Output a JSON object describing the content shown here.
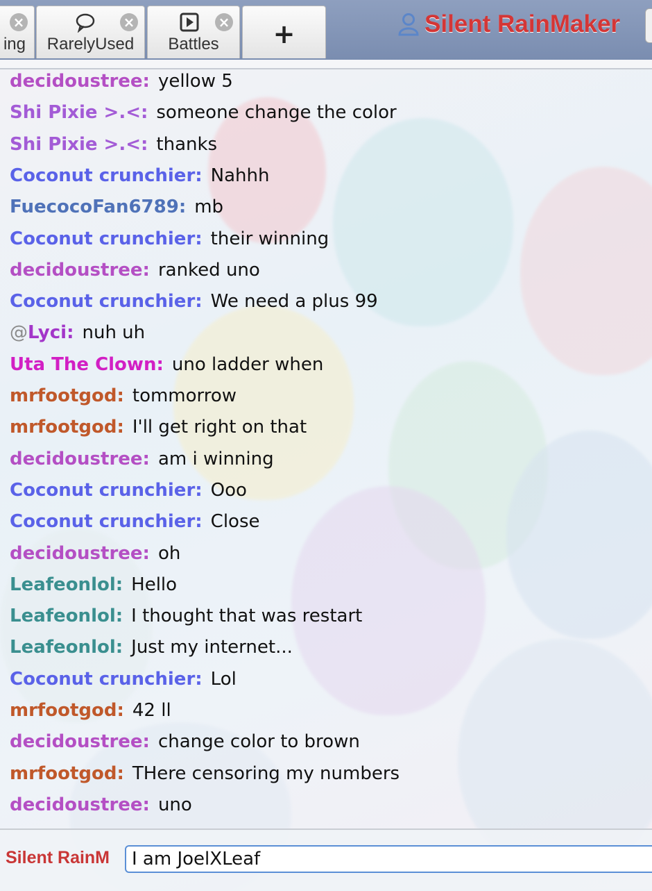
{
  "tabs": [
    {
      "label": "ing",
      "icon": "chat-icon"
    },
    {
      "label": "RarelyUsed",
      "icon": "chat-bubble-icon"
    },
    {
      "label": "Battles",
      "icon": "play-icon"
    }
  ],
  "new_tab_label": "+",
  "close_glyph": "×",
  "user": {
    "name": "Silent RainMaker",
    "icon": "user-icon",
    "color": "#d43636"
  },
  "messages": [
    {
      "user": "decidoustree:",
      "text": "yellow 5",
      "color": "#b44fc4"
    },
    {
      "user": "Shi Pixie >.<:",
      "text": "someone change the color",
      "color": "#a35bd6"
    },
    {
      "user": "Shi Pixie >.<:",
      "text": "thanks",
      "color": "#a35bd6"
    },
    {
      "user": "Coconut crunchier:",
      "text": "Nahhh",
      "color": "#5a62e8"
    },
    {
      "user": "FuecocoFan6789:",
      "text": "mb",
      "color": "#4f72b8"
    },
    {
      "user": "Coconut crunchier:",
      "text": "their winning",
      "color": "#5a62e8"
    },
    {
      "user": "decidoustree:",
      "text": "ranked uno",
      "color": "#b44fc4"
    },
    {
      "user": "Coconut crunchier:",
      "text": "We need a plus 99",
      "color": "#5a62e8"
    },
    {
      "prefix": "@",
      "user": "Lyci:",
      "text": "nuh uh",
      "color": "#a336c9"
    },
    {
      "user": "Uta The Clown:",
      "text": "uno ladder when",
      "color": "#d21fc4"
    },
    {
      "user": "mrfootgod:",
      "text": "tommorrow",
      "color": "#c0582a"
    },
    {
      "user": "mrfootgod:",
      "text": "I'll get right on that",
      "color": "#c0582a"
    },
    {
      "user": "decidoustree:",
      "text": "am i winning",
      "color": "#b44fc4"
    },
    {
      "user": "Coconut crunchier:",
      "text": "Ooo",
      "color": "#5a62e8"
    },
    {
      "user": "Coconut crunchier:",
      "text": "Close",
      "color": "#5a62e8"
    },
    {
      "user": "decidoustree:",
      "text": "oh",
      "color": "#b44fc4"
    },
    {
      "user": "Leafeonlol:",
      "text": "Hello",
      "color": "#3a8f8f"
    },
    {
      "user": "Leafeonlol:",
      "text": "I thought that was restart",
      "color": "#3a8f8f"
    },
    {
      "user": "Leafeonlol:",
      "text": "Just my internet...",
      "color": "#3a8f8f"
    },
    {
      "user": "Coconut crunchier:",
      "text": "Lol",
      "color": "#5a62e8"
    },
    {
      "user": "mrfootgod:",
      "text": "42 ll",
      "color": "#c0582a"
    },
    {
      "user": "decidoustree:",
      "text": "change color to brown",
      "color": "#b44fc4"
    },
    {
      "user": "mrfootgod:",
      "text": "THere censoring my numbers",
      "color": "#c0582a"
    },
    {
      "user": "decidoustree:",
      "text": "uno",
      "color": "#b44fc4"
    }
  ],
  "compose": {
    "user_label": "Silent RainM",
    "input_value": "I am JoelXLeaf"
  }
}
